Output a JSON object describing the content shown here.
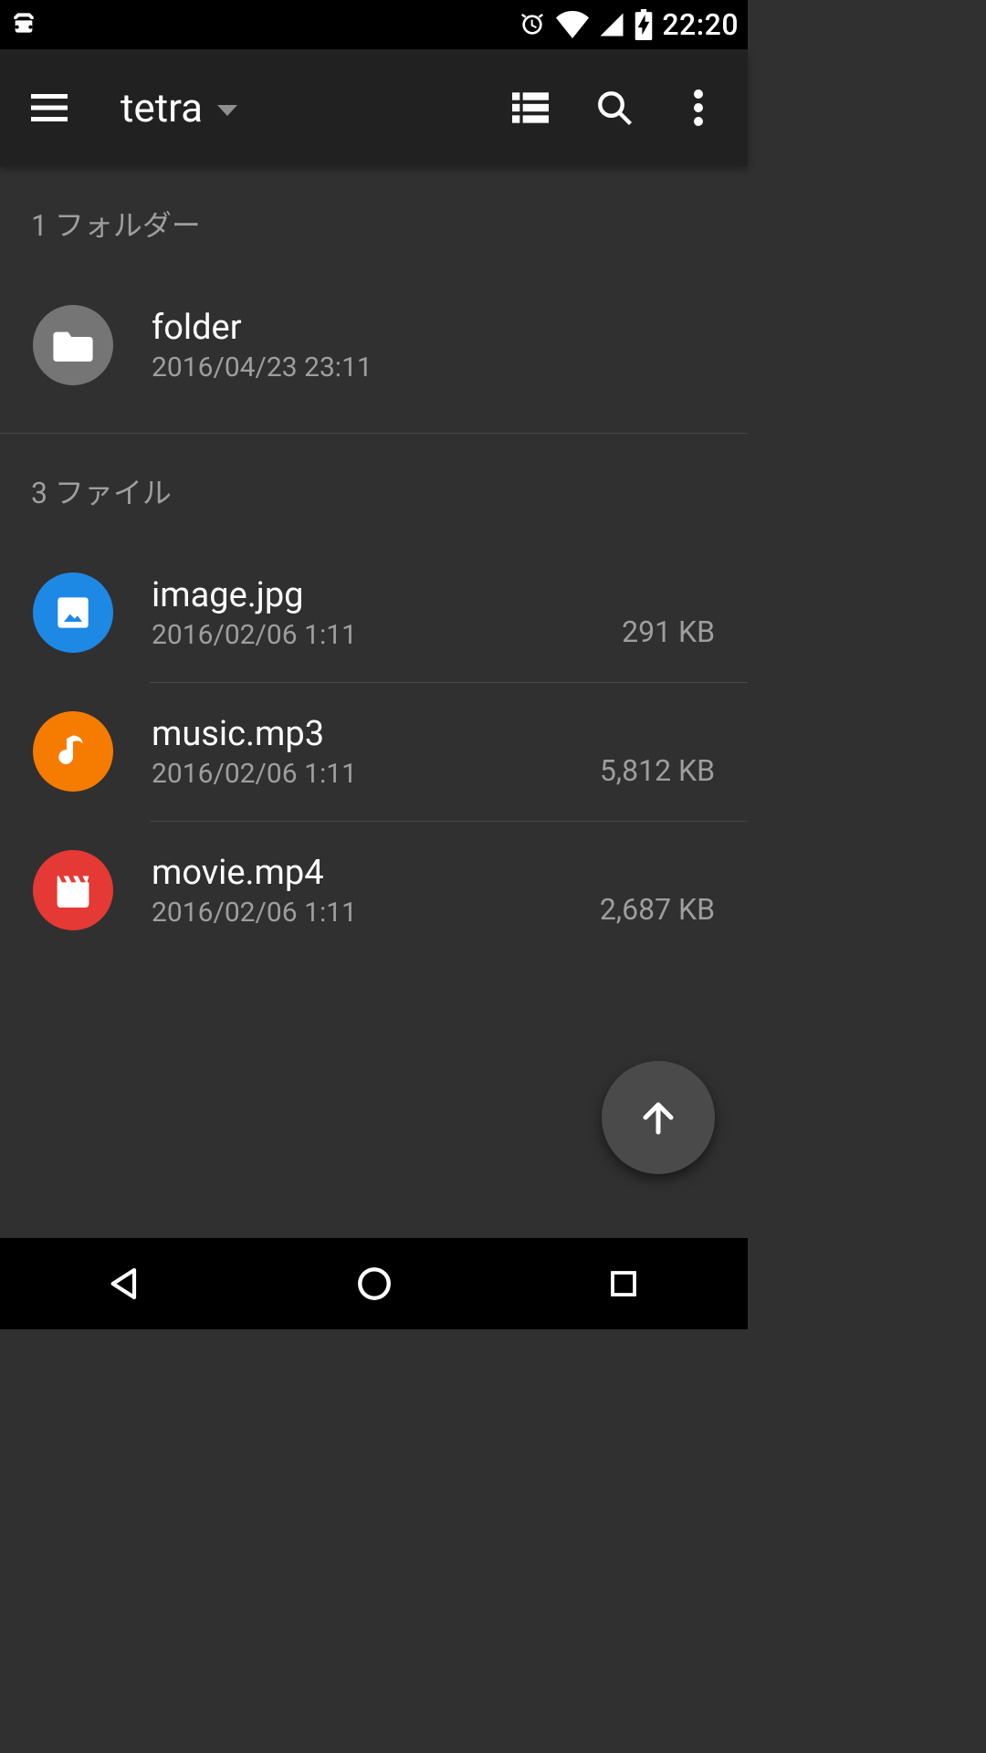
{
  "status": {
    "time": "22:20"
  },
  "appbar": {
    "title": "tetra"
  },
  "sections": {
    "folders_header": "1 フォルダー",
    "files_header": "3 ファイル"
  },
  "folders": [
    {
      "name": "folder",
      "date": "2016/04/23  23:11"
    }
  ],
  "files": [
    {
      "name": "image.jpg",
      "date": "2016/02/06  1:11",
      "size": "291 KB",
      "type": "image"
    },
    {
      "name": "music.mp3",
      "date": "2016/02/06  1:11",
      "size": "5,812 KB",
      "type": "music"
    },
    {
      "name": "movie.mp4",
      "date": "2016/02/06  1:11",
      "size": "2,687 KB",
      "type": "movie"
    }
  ],
  "icons": {
    "debug": "debug-icon",
    "alarm": "alarm-icon",
    "wifi": "wifi-icon",
    "cell": "cell-signal-icon",
    "battery": "battery-charging-icon"
  }
}
